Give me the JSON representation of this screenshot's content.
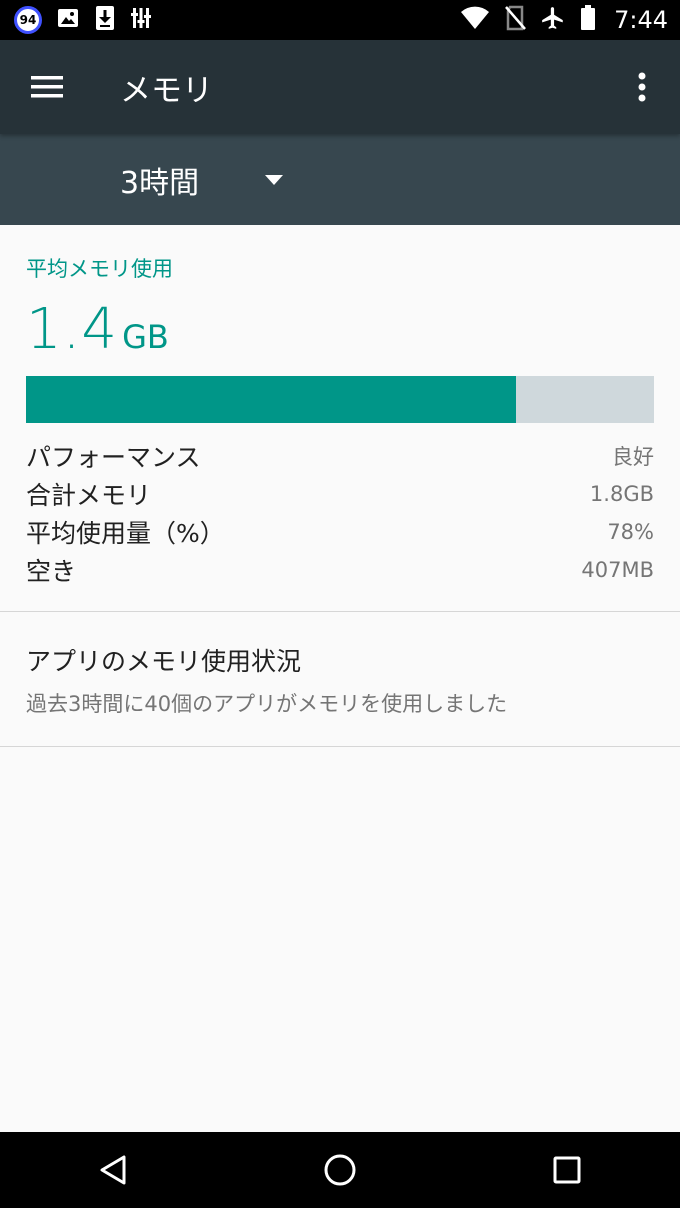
{
  "status_bar": {
    "notification_count": "94",
    "time": "7:44",
    "icons": [
      "image-icon",
      "download-icon",
      "usb-debug-icon",
      "wifi-icon",
      "no-sim-icon",
      "airplane-icon",
      "battery-icon"
    ]
  },
  "app_bar": {
    "title": "メモリ"
  },
  "spinner": {
    "selected": "3時間"
  },
  "summary": {
    "avg_label": "平均メモリ使用",
    "avg_value": "1.4",
    "avg_unit": "GB",
    "usage_fraction": 0.78
  },
  "stats": [
    {
      "label": "パフォーマンス",
      "value": "良好"
    },
    {
      "label": "合計メモリ",
      "value": "1.8GB"
    },
    {
      "label": "平均使用量（%）",
      "value": "78%"
    },
    {
      "label": "空き",
      "value": "407MB"
    }
  ],
  "app_usage": {
    "title": "アプリのメモリ使用状況",
    "subtitle": "過去3時間に40個のアプリがメモリを使用しました"
  },
  "colors": {
    "accent": "#009688",
    "app_bar": "#263238",
    "spinner_bar": "#37474f",
    "bar_track": "#cfd8dc"
  }
}
